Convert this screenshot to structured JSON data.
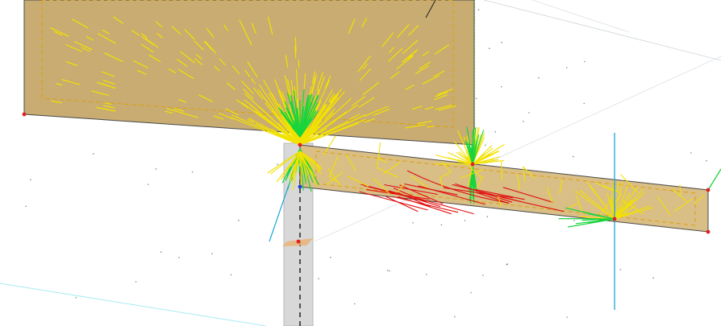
{
  "viewport": {
    "description_label": "",
    "background_color": "#ffffff"
  },
  "colors": {
    "surface_fill": "#c8ac72",
    "surface_fill_light": "#d9be86",
    "edge_line": "#4a4a4a",
    "dashed_outline": "#e0a000",
    "vector_yellow": "#f2e200",
    "vector_green": "#19d43c",
    "vector_red": "#e01010",
    "vector_cyan": "#1aa6d8",
    "node_red": "#e02020",
    "node_blue": "#2040d0",
    "column_fill": "#d8d8d8",
    "grid_line": "#cfd6da",
    "grid_line_cyan": "#a8ecf4"
  }
}
